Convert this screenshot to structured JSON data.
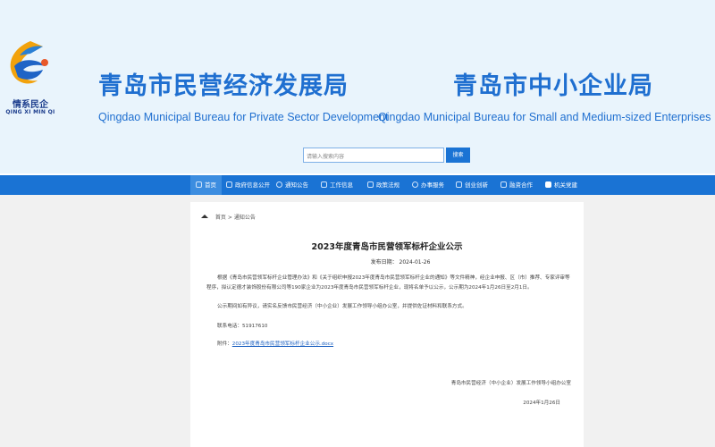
{
  "header": {
    "logo_text": "情系民企",
    "logo_sub": "QING XI MIN QI",
    "org1_cn": "青岛市民营经济发展局",
    "org1_en": "Qingdao Municipal Bureau for Private Sector Development",
    "org2_cn": "青岛市中小企业局",
    "org2_en": "Qingdao Municipal Bureau for Small and Medium-sized Enterprises",
    "search_placeholder": "请输入搜索内容",
    "search_button": "搜索"
  },
  "nav": [
    {
      "label": "首页",
      "icon": "home-icon"
    },
    {
      "label": "政府信息公开",
      "icon": "document-icon"
    },
    {
      "label": "通知公告",
      "icon": "chat-icon"
    },
    {
      "label": "工作信息",
      "icon": "monitor-icon"
    },
    {
      "label": "政策法规",
      "icon": "file-icon"
    },
    {
      "label": "办事服务",
      "icon": "stack-icon"
    },
    {
      "label": "创业创新",
      "icon": "copy-icon"
    },
    {
      "label": "融资合作",
      "icon": "briefcase-icon"
    },
    {
      "label": "机关党建",
      "icon": "party-icon"
    }
  ],
  "breadcrumb": {
    "home": "首页",
    "sep": ">",
    "current": "通知公告"
  },
  "article": {
    "title": "2023年度青岛市民营领军标杆企业公示",
    "date_label": "发布日期：",
    "date": "2024-01-26",
    "p1": "根据《青岛市民营领军标杆企业管理办法》和《关于组织申报2023年度青岛市民营领军标杆企业的通知》等文件精神，经企业申报、区（市）推荐、专家评审等程序，拟认定德才装饰股份有限公司等190家企业为2023年度青岛市民营领军标杆企业，现将名单予以公示，公示期为2024年1月26日至2月1日。",
    "p2": "公示期间如有异议，请实名反馈市民营经济（中小企业）发展工作领导小组办公室，并提供佐证材料和联系方式。",
    "phone_label": "联系电话：",
    "phone": "51917610",
    "attach_label": "附件：",
    "attach_file": "2023年度青岛市民营领军标杆企业公示.docx",
    "signature": "青岛市民营经济（中小企业）发展工作领导小组办公室",
    "sign_date": "2024年1月26日"
  }
}
